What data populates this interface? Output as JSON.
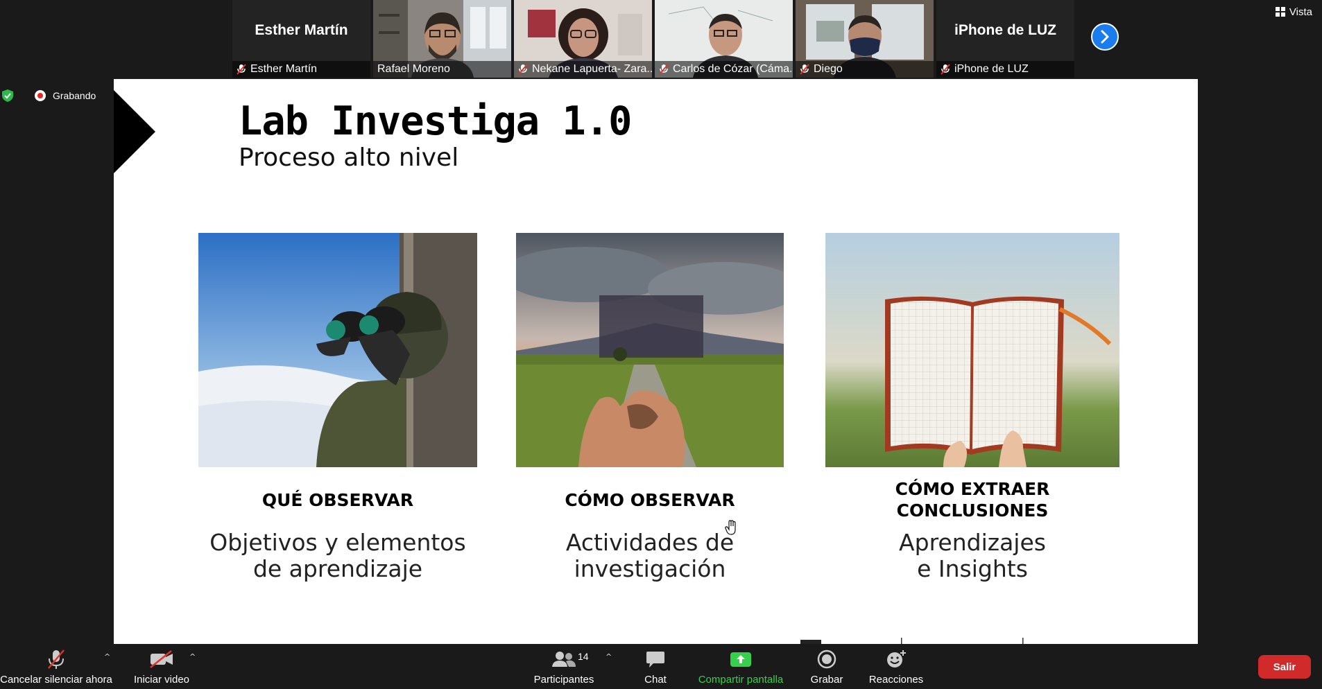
{
  "participants": [
    {
      "name": "Esther Martín",
      "label": "Esther Martín",
      "video": false,
      "muted": true
    },
    {
      "name": "Rafael Moreno",
      "label": "Rafael Moreno",
      "video": true,
      "muted": false,
      "active": true
    },
    {
      "name": "Nekane Lapuerta- Zara...",
      "label": "Nekane Lapuerta- Zara...",
      "video": true,
      "muted": true
    },
    {
      "name": "Carlos de Cózar (Cáma...",
      "label": "Carlos de Cózar (Cáma...",
      "video": true,
      "muted": true
    },
    {
      "name": "Diego",
      "label": "Diego",
      "video": true,
      "muted": true
    },
    {
      "name": "iPhone de LUZ",
      "label": "iPhone de LUZ",
      "video": false,
      "muted": true
    }
  ],
  "view_label": "Vista",
  "recording_label": "Grabando",
  "slide": {
    "title": "Lab Investiga 1.0",
    "subtitle": "Proceso alto nivel",
    "columns": [
      {
        "heading": "QUÉ OBSERVAR",
        "desc_lines": [
          "Objetivos y elementos",
          "de aprendizaje"
        ]
      },
      {
        "heading": "CÓMO OBSERVAR",
        "desc_lines": [
          "Actividades de",
          "investigación"
        ]
      },
      {
        "heading_lines": [
          "CÓMO EXTRAER",
          "CONCLUSIONES"
        ],
        "desc_lines": [
          "Aprendizajes",
          "e Insights"
        ]
      }
    ]
  },
  "toolbar": {
    "mute_label": "Cancelar silenciar ahora",
    "video_label": "Iniciar video",
    "participants_label": "Participantes",
    "participants_count": "14",
    "chat_label": "Chat",
    "share_label": "Compartir pantalla",
    "record_label": "Grabar",
    "reactions_label": "Reacciones",
    "leave_label": "Salir"
  },
  "colors": {
    "share_green": "#37d04a",
    "leave_red": "#d12a2a",
    "active_speaker": "#5bbf2b",
    "next_blue": "#1b7cf0"
  }
}
